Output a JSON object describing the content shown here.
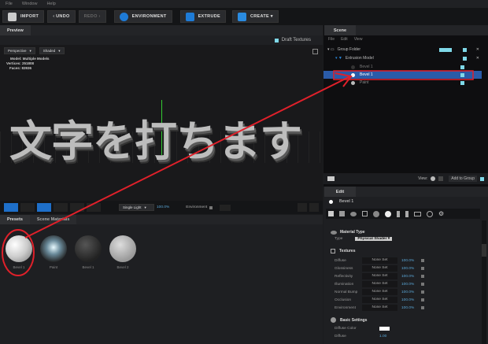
{
  "menu": [
    "File",
    "Window",
    "Help"
  ],
  "toolbar": {
    "import": "IMPORT",
    "undo": "‹ UNDO",
    "redo": "REDO ›",
    "environment": "ENVIRONMENT",
    "extrude": "EXTRUDE",
    "create": "CREATE ▾"
  },
  "preview": {
    "tab": "Preview",
    "draft": "Draft Textures",
    "projection": "Perspective",
    "shading": "Shaded",
    "model_label": "Model:",
    "model": "Multiple Models",
    "vertices_label": "Vertices:",
    "vertices": "251808",
    "faces_label": "Faces:",
    "faces": "83936",
    "text3d": "文字を打ちます"
  },
  "viewport_bar": {
    "light": "Single Light",
    "light_pct": "100.0%",
    "environment": "Environment"
  },
  "presets": {
    "tabs": [
      "Presets",
      "Scene Materials"
    ],
    "items": [
      "Bevel 1",
      "Paint",
      "Bevel 1",
      "Bevel 2"
    ]
  },
  "scene": {
    "tab": "Scene",
    "menu": [
      "File",
      "Edit",
      "View"
    ],
    "tree": [
      "Group Folder",
      "Extrusion Model",
      "Bevel 1",
      "Bevel 1",
      "Paint"
    ],
    "view": "View:",
    "add_group": "Add to Group"
  },
  "edit": {
    "tab": "Edit",
    "material": "Bevel 1",
    "material_type_header": "Material Type",
    "type_label": "Type",
    "type_value": "Physical Shader",
    "textures_header": "Textures",
    "textures": [
      {
        "name": "Diffuse",
        "value": "None Set",
        "pct": "100.0%"
      },
      {
        "name": "Glossiness",
        "value": "None Set",
        "pct": "100.0%"
      },
      {
        "name": "Reflectivity",
        "value": "None Set",
        "pct": "100.0%"
      },
      {
        "name": "Illumination",
        "value": "None Set",
        "pct": "100.0%"
      },
      {
        "name": "Normal Bump",
        "value": "None Set",
        "pct": "100.0%"
      },
      {
        "name": "Occlusion",
        "value": "None Set",
        "pct": "100.0%"
      },
      {
        "name": "Environment",
        "value": "None Set",
        "pct": "100.0%"
      }
    ],
    "basic_header": "Basic Settings",
    "diffuse_color": "Diffuse Color",
    "diffuse": "Diffuse",
    "diffuse_value": "1.00"
  },
  "colors": {
    "accent": "#7fd8e8",
    "selection": "#2a5ba8",
    "annotation": "#e0202a"
  }
}
